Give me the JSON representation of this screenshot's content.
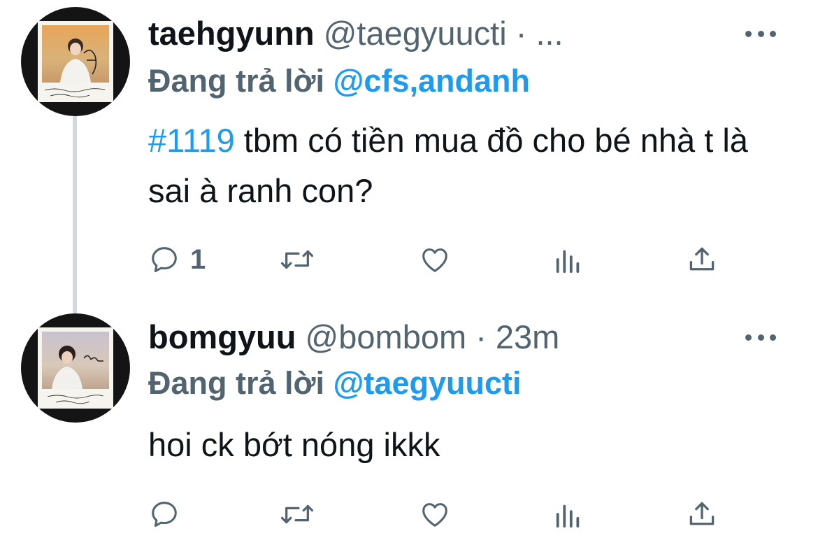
{
  "tweets": [
    {
      "display_name": "taehgyunn",
      "handle": "@taegyuucti",
      "separator": "·",
      "timestamp": "...",
      "reply_prefix": "Đang trả lời",
      "reply_to": "@cfs,andanh",
      "hashtag": "#1119",
      "text": " tbm có tiền mua đồ cho bé nhà t là sai à ranh con?",
      "reply_count": "1",
      "avatar_icon": "profile-photo-polaroid"
    },
    {
      "display_name": "bomgyuu",
      "handle": "@bombom",
      "separator": "·",
      "timestamp": "23m",
      "reply_prefix": "Đang trả lời",
      "reply_to": "@taegyuucti",
      "hashtag": "",
      "text": "hoi ck bớt nóng ikkk",
      "reply_count": "",
      "avatar_icon": "profile-photo-polaroid"
    }
  ],
  "icons": {
    "reply": "reply-icon",
    "retweet": "retweet-icon",
    "like": "like-icon",
    "views": "views-icon",
    "share": "share-icon",
    "more": "more-icon"
  },
  "colors": {
    "text": "#0f1419",
    "secondary": "#536471",
    "accent": "#1d9bf0",
    "thread_line": "#cfd9de"
  }
}
